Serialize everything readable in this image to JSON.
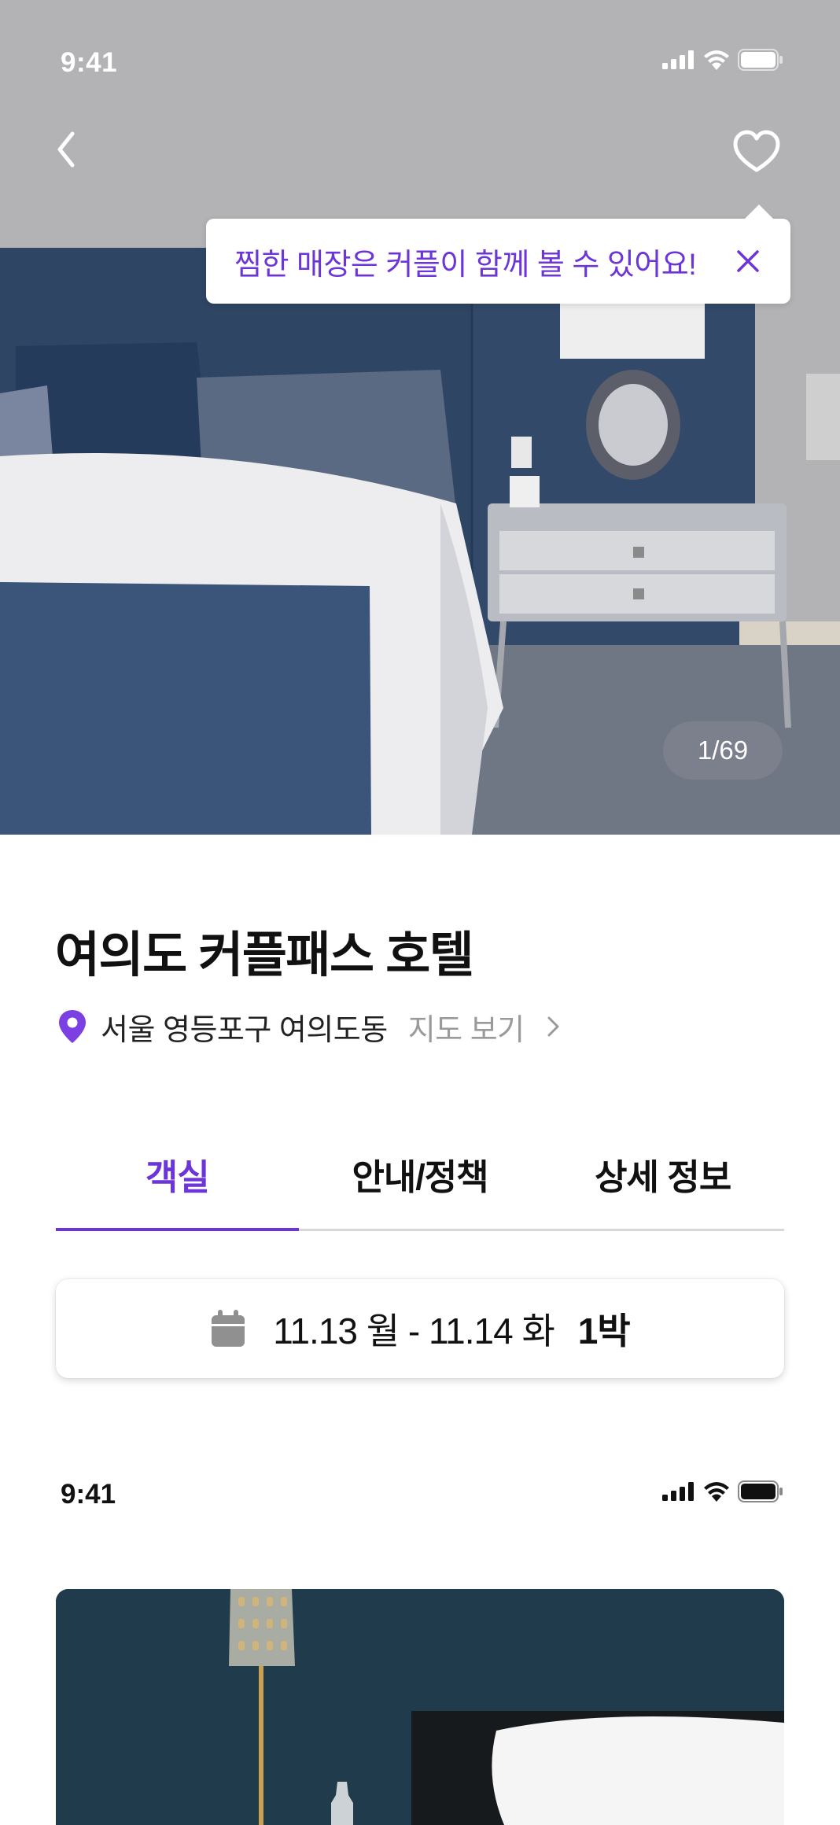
{
  "status_bar": {
    "time": "9:41"
  },
  "hero": {
    "back_icon": "chevron-left-icon",
    "favorite_icon": "heart-outline-icon",
    "tooltip": {
      "text": "찜한 매장은 커플이 함께 볼 수 있어요!",
      "close_icon": "close-icon"
    },
    "photo_counter": "1/69"
  },
  "hotel": {
    "name": "여의도 커플패스 호텔",
    "address": "서울 영등포구 여의도동",
    "map_link": "지도 보기"
  },
  "tabs": [
    {
      "label": "객실",
      "active": true
    },
    {
      "label": "안내/정책",
      "active": false
    },
    {
      "label": "상세 정보",
      "active": false
    }
  ],
  "date_picker": {
    "icon": "calendar-icon",
    "range": "11.13 월 - 11.14 화",
    "nights": "1박"
  },
  "status_bar_2": {
    "time": "9:41"
  },
  "colors": {
    "accent": "#6b35d8",
    "text": "#111111",
    "muted": "#9a9a9a"
  }
}
